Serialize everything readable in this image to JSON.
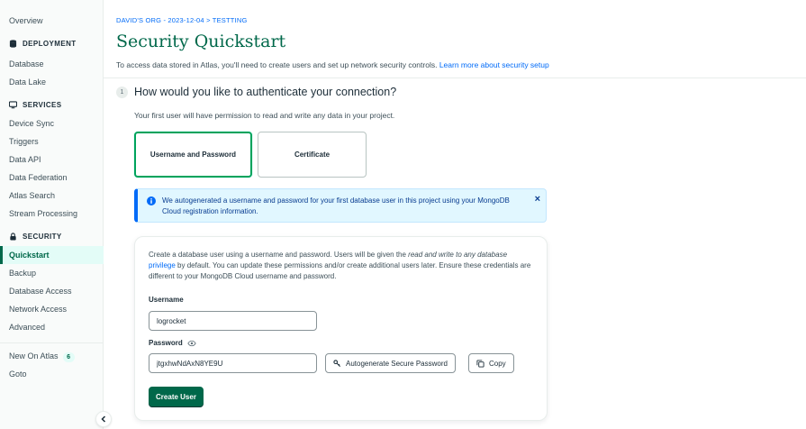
{
  "sidebar": {
    "overview": "Overview",
    "deployment": {
      "title": "DEPLOYMENT",
      "items": [
        "Database",
        "Data Lake"
      ]
    },
    "services": {
      "title": "SERVICES",
      "items": [
        "Device Sync",
        "Triggers",
        "Data API",
        "Data Federation",
        "Atlas Search",
        "Stream Processing"
      ]
    },
    "security": {
      "title": "SECURITY",
      "active": "Quickstart",
      "items": [
        "Backup",
        "Database Access",
        "Network Access",
        "Advanced"
      ]
    },
    "new_on_atlas": "New On Atlas",
    "new_count": "6",
    "goto": "Goto"
  },
  "header": {
    "breadcrumb": "DAVID'S ORG - 2023-12-04 > TESTTING",
    "title": "Security Quickstart",
    "description": "To access data stored in Atlas, you'll need to create users and set up network security controls.",
    "learn_more": "Learn more about security setup"
  },
  "step": {
    "number": "1",
    "title": "How would you like to authenticate your connection?",
    "description": "Your first user will have permission to read and write any data in your project."
  },
  "auth_options": {
    "username_password": "Username and Password",
    "certificate": "Certificate"
  },
  "banner": {
    "text": "We autogenerated a username and password for your first database user in this project using your MongoDB Cloud registration information.",
    "close": "×"
  },
  "form": {
    "desc_part1": "Create a database user using a username and password. Users will be given the ",
    "desc_italic": "read and write to any database",
    "desc_link": "privilege",
    "desc_part2": " by default. You can update these permissions and/or create additional users later. Ensure these credentials are different to your MongoDB Cloud username and password.",
    "username_label": "Username",
    "username_value": "logrocket",
    "password_label": "Password",
    "password_value": "jtgxhwNdAxN8YE9U",
    "autogenerate_label": "Autogenerate Secure Password",
    "copy_label": "Copy",
    "create_label": "Create User"
  },
  "colors": {
    "brand_green": "#00684a",
    "link_blue": "#016bf8",
    "banner_bg": "#e1f7ff"
  }
}
